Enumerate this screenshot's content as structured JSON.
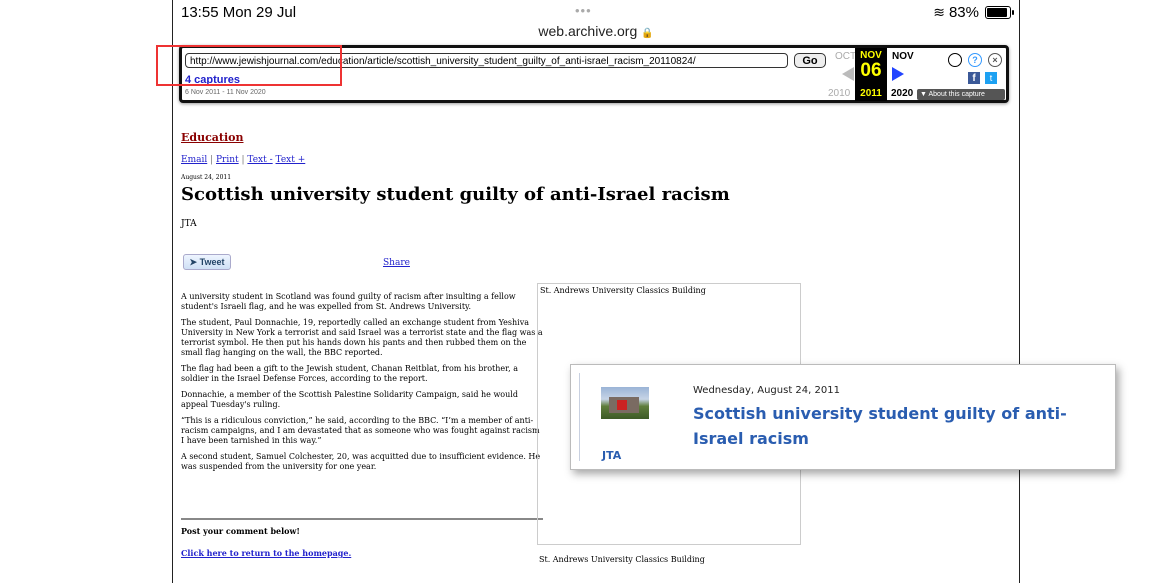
{
  "status": {
    "time": "13:55  Mon 29 Jul",
    "dots": "•••",
    "battery": "83%"
  },
  "browser": {
    "domain": "web.archive.org"
  },
  "wayback": {
    "url": "http://www.jewishjournal.com/education/article/scottish_university_student_guilty_of_anti-israel_racism_20110824/",
    "go": "Go",
    "captures": "4 captures",
    "range": "6 Nov 2011 - 11 Nov 2020",
    "prev_month": "OCT",
    "cur_month": "NOV",
    "cur_day": "06",
    "cur_year": "2011",
    "next_month": "NOV",
    "prev_year": "2010",
    "next_year": "2020",
    "about": "▼ About this capture"
  },
  "page": {
    "section": "Education",
    "links": {
      "email": "Email",
      "print": "Print",
      "text_minus": "Text -",
      "text_plus": "Text +"
    },
    "date": "August 24, 2011",
    "headline": "Scottish university student guilty of anti-Israel racism",
    "byline": "JTA",
    "tweet": "Tweet",
    "share": "Share",
    "paragraphs": [
      "A university student in Scotland was found guilty of racism after insulting a fellow student's Israeli flag, and he was expelled from St. Andrews University.",
      "The student, Paul Donnachie, 19, reportedly called an exchange student from Yeshiva University in New York a terrorist and said Israel was a terrorist state and the flag was a terrorist symbol. He then put his hands down his pants and then rubbed them on the small flag hanging on the wall, the BBC reported.",
      "The flag had been a gift to the Jewish student, Chanan Reitblat, from his brother, a soldier in the Israel Defense Forces, according to the report.",
      "Donnachie, a member of the Scottish Palestine Solidarity Campaign, said he would appeal Tuesday's ruling.",
      "“This is a ridiculous conviction,” he said, according to the BBC. “I’m a member of anti-racism campaigns, and I am devastated that as someone who was fought against racism I have been tarnished in this way.”",
      "A second student, Samuel Colchester, 20, was acquitted due to insufficient evidence. He was suspended from the university for one year."
    ],
    "post_comment": "Post your comment below!",
    "home_link": "Click here to return to the homepage.",
    "image_caption_top": "St. Andrews University Classics Building",
    "image_caption_bottom": "St. Andrews University Classics Building"
  },
  "card": {
    "date": "Wednesday, August 24, 2011",
    "title": "Scottish university student guilty of anti-Israel racism",
    "source": "JTA"
  }
}
